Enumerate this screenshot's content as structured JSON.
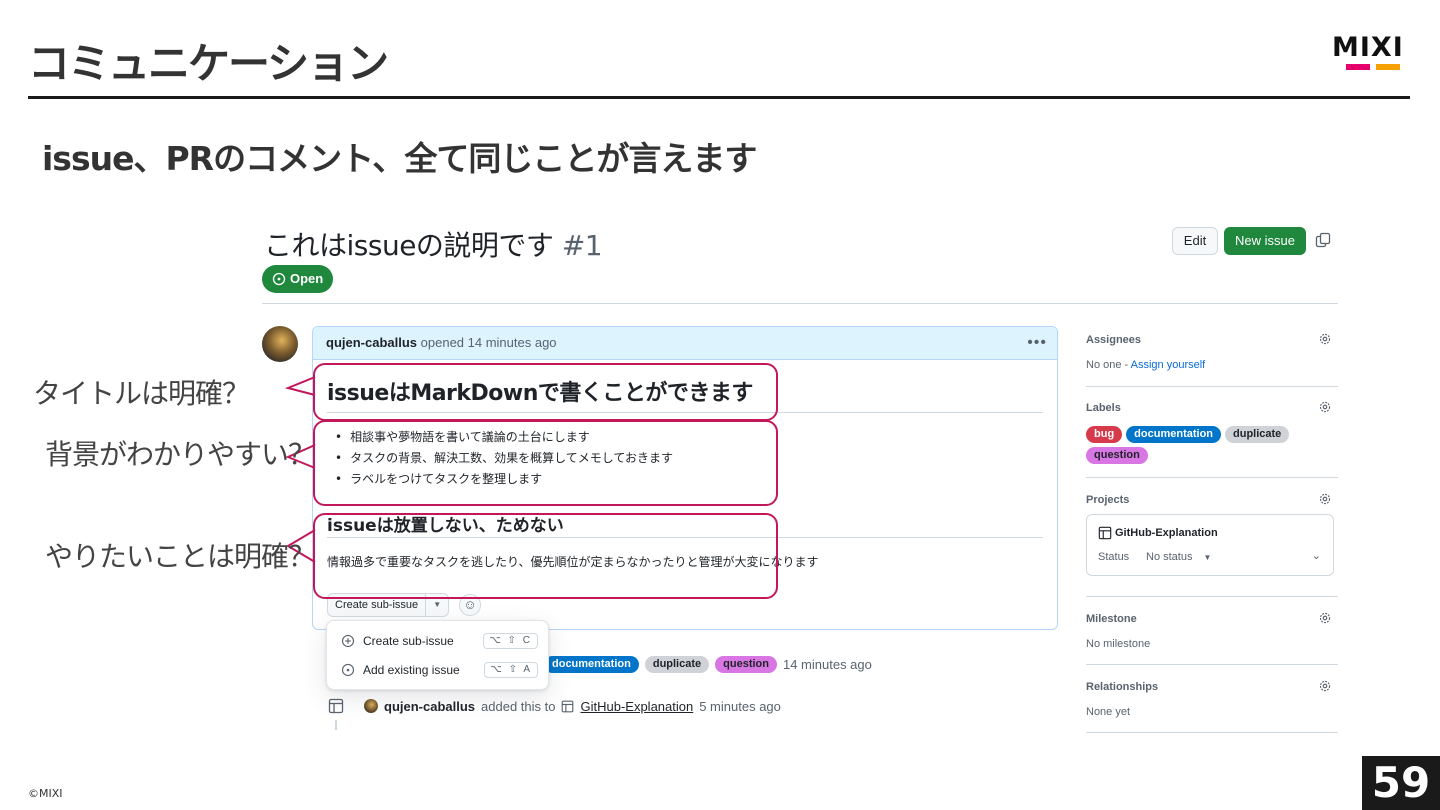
{
  "slide": {
    "title": "コミュニケーション",
    "subtitle": "issue、PRのコメント、全て同じことが言えます",
    "logo_text": "MIXI",
    "logo_colors": [
      "#e5006e",
      "#f5a200"
    ],
    "copyright": "©MIXI",
    "page_number": "59"
  },
  "issue": {
    "title": "これはissueの説明です",
    "number": "#1",
    "edit_label": "Edit",
    "new_issue_label": "New issue",
    "state": "Open",
    "colors": {
      "open_green": "#1f883d",
      "link_blue": "#0969da",
      "annotation": "#c2185b"
    }
  },
  "comment": {
    "author": "qujen-caballus",
    "meta": "opened 14 minutes ago",
    "heading": "issueはMarkDownで書くことができます",
    "bullets": [
      "相談事や夢物語を書いて議論の土台にします",
      "タスクの背景、解決工数、効果を概算してメモしておきます",
      "ラベルをつけてタスクを整理します"
    ],
    "subheading": "issueは放置しない、ためない",
    "paragraph": "情報過多で重要なタスクを逃したり、優先順位が定まらなかったりと管理が大変になります",
    "create_sub_issue": "Create sub-issue"
  },
  "menu": {
    "items": [
      {
        "label": "Create sub-issue",
        "shortcut": "⌥ ⇧ C"
      },
      {
        "label": "Add existing issue",
        "shortcut": "⌥ ⇧ A"
      }
    ]
  },
  "timeline": {
    "label_event": {
      "labels": [
        "documentation",
        "duplicate",
        "question"
      ],
      "time": "14 minutes ago"
    },
    "project_event": {
      "author": "qujen-caballus",
      "action": "added this to",
      "project": "GitHub-Explanation",
      "time": "5 minutes ago"
    }
  },
  "sidebar": {
    "assignees": {
      "heading": "Assignees",
      "value": "No one - ",
      "link": "Assign yourself"
    },
    "labels": {
      "heading": "Labels",
      "items": [
        {
          "name": "bug",
          "bg": "#d73a4a",
          "fg": "#ffffff"
        },
        {
          "name": "documentation",
          "bg": "#0075ca",
          "fg": "#ffffff"
        },
        {
          "name": "duplicate",
          "bg": "#cfd3d7",
          "fg": "#1f2328"
        },
        {
          "name": "question",
          "bg": "#d876e3",
          "fg": "#1f2328"
        }
      ]
    },
    "projects": {
      "heading": "Projects",
      "name": "GitHub-Explanation",
      "status_label": "Status",
      "status_value": "No status"
    },
    "milestone": {
      "heading": "Milestone",
      "value": "No milestone"
    },
    "relationships": {
      "heading": "Relationships",
      "value": "None yet"
    }
  },
  "annotations": {
    "title_check": "タイトルは明確？",
    "background_check": "背景がわかりやすい？",
    "intent_check": "やりたいことは明確？"
  }
}
